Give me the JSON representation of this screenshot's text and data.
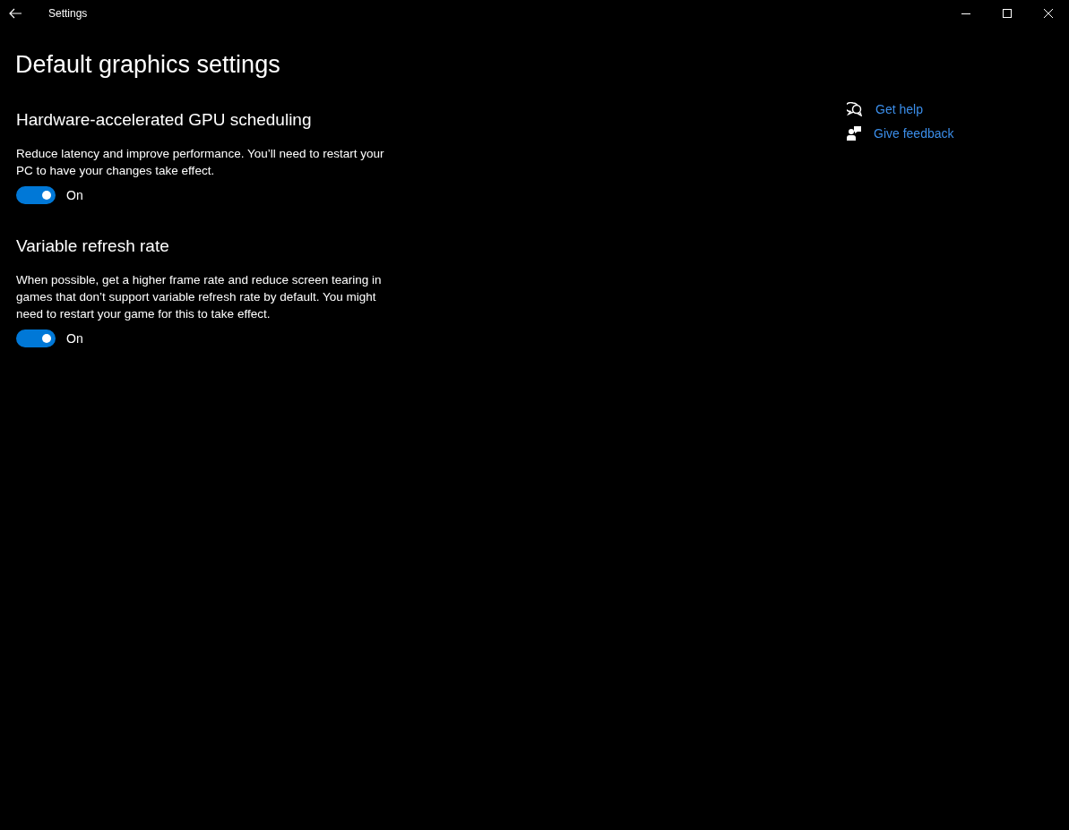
{
  "window": {
    "title": "Settings"
  },
  "page_title": "Default graphics settings",
  "sections": [
    {
      "heading": "Hardware-accelerated GPU scheduling",
      "description": "Reduce latency and improve performance. You’ll need to restart your PC to have your changes take effect.",
      "toggle": {
        "on": true,
        "label": "On"
      }
    },
    {
      "heading": "Variable refresh rate",
      "description": "When possible, get a higher frame rate and reduce screen tearing in games that don’t support variable refresh rate by default. You might need to restart your game for this to take effect.",
      "toggle": {
        "on": true,
        "label": "On"
      }
    }
  ],
  "help_links": [
    {
      "kind": "help",
      "label": "Get help"
    },
    {
      "kind": "feedback",
      "label": "Give feedback"
    }
  ]
}
